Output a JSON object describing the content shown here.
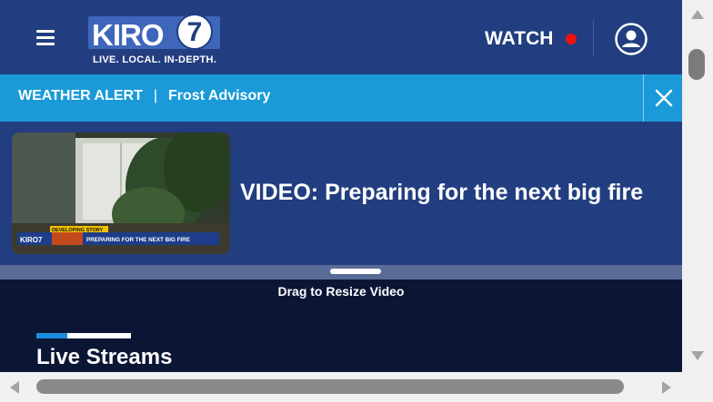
{
  "header": {
    "logo_text": "KIRO",
    "logo_number": "7",
    "logo_tagline": "LIVE. LOCAL. IN-DEPTH.",
    "watch_label": "WATCH",
    "menu_icon": "hamburger-menu-icon",
    "account_icon": "user-account-icon"
  },
  "alert": {
    "label": "WEATHER ALERT",
    "separator": "|",
    "message": "Frost Advisory",
    "close_icon": "close-icon"
  },
  "video": {
    "title": "VIDEO: Preparing for the next big fire",
    "thumbnail_overlay": {
      "tag": "DEVELOPING STORY",
      "ticker": "PREPARING FOR THE NEXT BIG FIRE",
      "corner_logo": "KIRO7"
    },
    "resize_hint": "Drag to Resize Video"
  },
  "section": {
    "title": "Live Streams"
  },
  "colors": {
    "header_bg": "#223e80",
    "alert_bg": "#1a9ad8",
    "page_bg": "#0b1635",
    "live_dot": "#e11111",
    "accent_blue": "#1a8be0"
  }
}
